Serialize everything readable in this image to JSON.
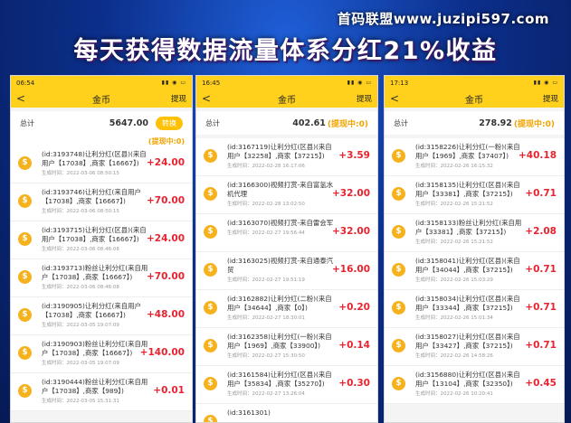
{
  "watermark": "首码联盟www.juzipi597.com",
  "headline": "每天获得数据流量体系分红21%收益",
  "phones": [
    {
      "time": "06:54",
      "title": "金币",
      "action": "提现",
      "total_label": "总计",
      "total_value": "5647.00",
      "total_extra": "",
      "button": "转换",
      "pending": "(提现中:0)",
      "rows": [
        {
          "desc": "(id:3193748)让利分红(区县)(来自用户【17038】,商家【16667】)",
          "time": "生成时间：2022-03-06 08:50:15",
          "amount": "+24.00"
        },
        {
          "desc": "(id:3193746)让利分红(来自用户【17038】,商家【16667】)",
          "time": "生成时间：2022-03-06 08:50:15",
          "amount": "+70.00"
        },
        {
          "desc": "(id:3193715)让利分红(区县)(来自用户【17038】,商家【16667】)",
          "time": "生成时间：2022-03-06 08:46:08",
          "amount": "+24.00"
        },
        {
          "desc": "(id:3193713)粉丝让利分红(来自用户【17038】,商家【16667】)",
          "time": "生成时间：2022-03-06 08:46:08",
          "amount": "+70.00"
        },
        {
          "desc": "(id:3190905)让利分红(来自用户【17038】,商家【16667】)",
          "time": "生成时间：2022-03-05 19:07:09",
          "amount": "+48.00"
        },
        {
          "desc": "(id:3190903)粉丝让利分红(来自用户【17038】,商家【16667】)",
          "time": "生成时间：2022-03-05 19:07:09",
          "amount": "+140.00"
        },
        {
          "desc": "(id:3190444)粉丝让利分红(来自用户【17038】,商家【989】)",
          "time": "生成时间：2022-03-05 15:31:31",
          "amount": "+0.01"
        }
      ]
    },
    {
      "time": "16:45",
      "title": "金币",
      "action": "提现",
      "total_label": "总计",
      "total_value": "402.61",
      "total_extra": "(提现中:0)",
      "button": "",
      "pending": "",
      "rows": [
        {
          "desc": "(id:3167119)让利分红(区县)(来自用户【32258】,商家【37215】)",
          "time": "生成时间：2022-02-28 16:17:06",
          "amount": "+3.59"
        },
        {
          "desc": "(id:3166300)视频打赏-来自富氢水机代理",
          "time": "生成时间：2022-02-28 13:02:50",
          "amount": "+32.00"
        },
        {
          "desc": "(id:3163070)视频打赏-来自雷会军",
          "time": "生成时间：2022-02-27 19:56:44",
          "amount": "+32.00"
        },
        {
          "desc": "(id:3163025)视频打赏-来自通泰汽贸",
          "time": "生成时间：2022-02-27 19:51:19",
          "amount": "+16.00"
        },
        {
          "desc": "(id:3162882)让利分红(二粉)(来自用户【34644】,商家【0】)",
          "time": "生成时间：2022-02-27 18:30:01",
          "amount": "+0.20"
        },
        {
          "desc": "(id:3162358)让利分红(一粉)(来自用户【1969】,商家【33900】)",
          "time": "生成时间：2022-02-27 15:30:50",
          "amount": "+0.14"
        },
        {
          "desc": "(id:3161584)让利分红(区县)(来自用户【35834】,商家【35270】)",
          "time": "生成时间：2022-02-27 13:26:04",
          "amount": "+0.30"
        },
        {
          "desc": "(id:3161301)",
          "time": "",
          "amount": ""
        }
      ]
    },
    {
      "time": "17:13",
      "title": "金币",
      "action": "提现",
      "total_label": "总计",
      "total_value": "278.92",
      "total_extra": "(提现中:0)",
      "button": "",
      "pending": "",
      "rows": [
        {
          "desc": "(id:3158226)让利分红(一粉)(来自用户【1969】,商家【37407】)",
          "time": "生成时间：2022-02-26 16:15:32",
          "amount": "+40.18"
        },
        {
          "desc": "(id:3158135)让利分红(区县)(来自用户【33381】,商家【37215】)",
          "time": "生成时间：2022-02-26 15:21:52",
          "amount": "+0.71"
        },
        {
          "desc": "(id:3158133)粉丝让利分红(来自用户【33381】,商家【37215】)",
          "time": "生成时间：2022-02-26 15:21:52",
          "amount": "+2.08"
        },
        {
          "desc": "(id:3158041)让利分红(区县)(来自用户【34044】,商家【37215】)",
          "time": "生成时间：2022-02-26 15:03:29",
          "amount": "+0.71"
        },
        {
          "desc": "(id:3158034)让利分红(区县)(来自用户【33344】,商家【37215】)",
          "time": "生成时间：2022-02-26 15:01:34",
          "amount": "+0.71"
        },
        {
          "desc": "(id:3158027)让利分红(区县)(来自用户【33427】,商家【37215】)",
          "time": "生成时间：2022-02-26 14:58:26",
          "amount": "+0.71"
        },
        {
          "desc": "(id:3156880)让利分红(区县)(来自用户【13104】,商家【32350】)",
          "time": "生成时间：2022-02-26 10:20:41",
          "amount": "+0.45"
        }
      ]
    }
  ],
  "icons": {
    "back": "chevron-left-icon",
    "coin": "coin-icon"
  },
  "colors": {
    "header": "#ffd11c",
    "amount": "#e8232f",
    "accent": "#f2a400"
  }
}
